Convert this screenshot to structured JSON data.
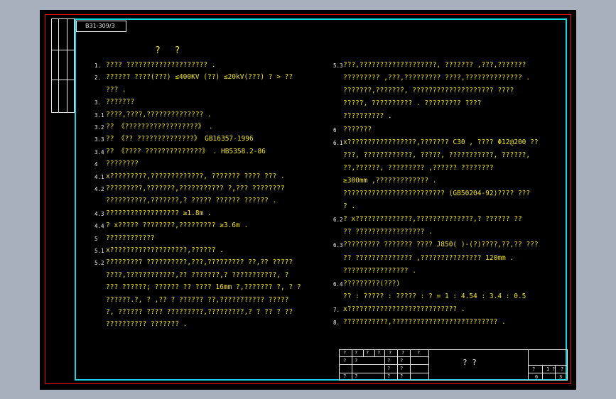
{
  "drawing_code": "B31-309/3",
  "title": "? ?",
  "left_column": [
    {
      "num": "1.",
      "text": "????  ????????????????????        ."
    },
    {
      "num": "2.",
      "text": "??????  ????(???)   ≤400KV     (??)         ≤20kV(???) ? > ??"
    },
    {
      "num": "",
      "text": "??? ."
    },
    {
      "num": "3.",
      "text": "???????"
    },
    {
      "num": "3.1",
      "text": "????,????,??????????????        ."
    },
    {
      "num": "3.2",
      "text": "??  《??????????????????》       ."
    },
    {
      "num": "3.3",
      "text": "??  《??  ??????????????》       GB16357-1996"
    },
    {
      "num": "3.4",
      "text": "??  《????  ??????????????》     .   HB5358.2-86"
    },
    {
      "num": "4",
      "text": "????????"
    },
    {
      "num": "4.1",
      "text": "x?????????,?????????????,          ???????  ????  ???  ."
    },
    {
      "num": "4.2",
      "text": "?????????,???????,???????????         ?,???  ????????"
    },
    {
      "num": "",
      "text": "??????????,???????,?          ?????  ??????  ??????       ."
    },
    {
      "num": "4.3",
      "text": "??????????????????         ≥1.8m  ."
    },
    {
      "num": "4.4",
      "text": "? x?????       ????????,?????????      ≥3.6m  ."
    },
    {
      "num": "5",
      "text": "????????????"
    },
    {
      "num": "5.1",
      "text": "x???????????????????,??????            ."
    },
    {
      "num": "5.2",
      "text": "?????????   ??????????,???,?????????         ??,??    ?????"
    },
    {
      "num": "",
      "text": "????,????????????,??        ???????,?   ???????????,     ?"
    },
    {
      "num": "",
      "text": "??? ??????;  ??????    ?? ????   16mm       ?,???????       ?, ?  ?"
    },
    {
      "num": "",
      "text": "??????.?,   ?   ,??  ?       ??????   ??,???????????         ?????"
    },
    {
      "num": "",
      "text": "?, ??????  ????  ?????????,?????????,?       ?   ??  ? ??"
    },
    {
      "num": "",
      "text": "??????????     ???????    ."
    }
  ],
  "right_column": [
    {
      "num": "5.3",
      "text": "???,???????????????????,          ???????    ,???,???????"
    },
    {
      "num": "",
      "text": "?????????    ,???,?????????     ????,??????????????         ."
    },
    {
      "num": "",
      "text": "???????,???????,      ????????????????????        ????"
    },
    {
      "num": "",
      "text": "?????,  ??????????        .             ?????????  ????"
    },
    {
      "num": "",
      "text": "??????????        ."
    },
    {
      "num": "6",
      "text": "???????"
    },
    {
      "num": "6.1",
      "text": "x?????????????????,???????        C30  ,  ????   Φ12@200        ??"
    },
    {
      "num": "",
      "text": "???,  ????????????,    ?????,  ???????????,               ??????,"
    },
    {
      "num": "",
      "text": "??,??????,            ?????????   ,??????     ????????"
    },
    {
      "num": "",
      "text": "≥300mm  ,?????????????         ."
    },
    {
      "num": "",
      "text": "?????????????????????????         (GB50204-92)????  ???"
    },
    {
      "num": "",
      "text": "? ."
    },
    {
      "num": "6.2",
      "text": "? x??????????????,??????????????,?               ??????   ??"
    },
    {
      "num": "",
      "text": "?? ?????????????????       ."
    },
    {
      "num": "6.3",
      "text": "?????????      ???????       ????      J850(  )-(?)????,??,??    ???"
    },
    {
      "num": "",
      "text": "??  ??????????????        ,???????????????           120mm  ."
    },
    {
      "num": "",
      "text": "????????????????         ."
    },
    {
      "num": "6.4",
      "text": "?????????(???)"
    },
    {
      "num": "",
      "text": "??  :  ?????  :   ?????  :  ?     = 1 : 4.54 : 3.4 : 0.5"
    },
    {
      "num": "7.",
      "text": "x???????????????????????????         ."
    },
    {
      "num": "8.",
      "text": "???????????,??????????????????????????         ."
    }
  ],
  "title_block": {
    "header_row": [
      "?",
      "?",
      "?",
      "?",
      "?",
      "?",
      "?"
    ],
    "rows": [
      [
        "?",
        "?",
        "",
        "?",
        "?"
      ],
      [
        "",
        "",
        "",
        "?",
        "?"
      ],
      [
        "?",
        "?",
        "",
        "?",
        "?"
      ]
    ],
    "center_title": "?   ?",
    "right_labels": [
      "?",
      "1",
      "?",
      "?"
    ],
    "right_values": [
      "6",
      "3"
    ]
  }
}
